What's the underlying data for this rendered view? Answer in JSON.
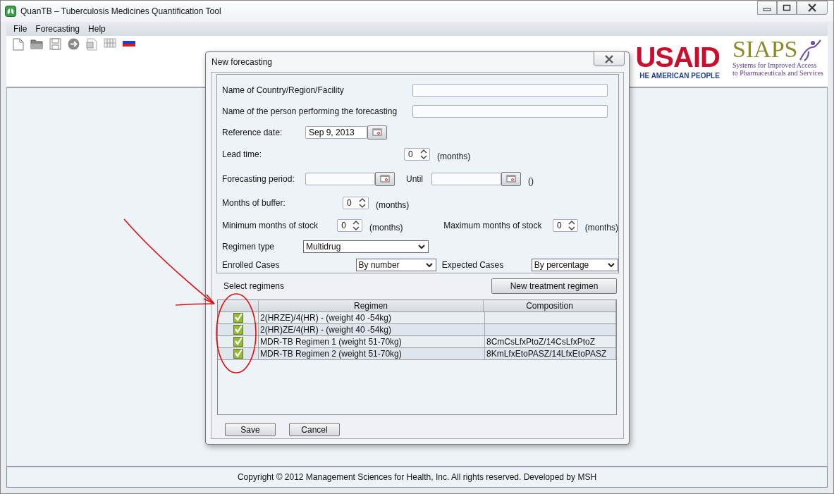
{
  "window": {
    "title": "QuanTB – Tuberculosis Medicines Quantification Tool"
  },
  "menu": [
    "File",
    "Forecasting",
    "Help"
  ],
  "logos": {
    "usaid": "USAID",
    "usaid_tagline": "HE AMERICAN PEOPLE",
    "siaps": "SIAPS",
    "siaps_tagline": [
      "Systems for Improved Access",
      "to Pharmaceuticals and Services"
    ]
  },
  "dialog": {
    "title": "New forecasting",
    "country_label": "Name of Country/Region/Facility",
    "person_label": "Name of the person performing the forecasting",
    "reference_label": "Reference date:",
    "reference_value": "Sep 9, 2013",
    "lead_label": "Lead time:",
    "lead_value": "0",
    "lead_unit": "(months)",
    "period_label": "Forecasting period:",
    "until_label": "Until",
    "period_unit": "()",
    "buffer_label": "Months of buffer:",
    "buffer_value": "0",
    "buffer_unit": "(months)",
    "min_label": "Minimum months of stock",
    "min_value": "0",
    "min_unit": "(months)",
    "max_label": "Maximum months of stock",
    "max_value": "0",
    "max_unit": "(months)",
    "regimen_type_label": "Regimen type",
    "regimen_type_value": "Multidrug",
    "enrolled_label": "Enrolled Cases",
    "enrolled_value": "By number",
    "expected_label": "Expected Cases",
    "expected_value": "By percentage",
    "select_label": "Select regimens",
    "new_regimen_button": "New treatment regimen",
    "table": {
      "columns": [
        "Regimen",
        "Composition"
      ],
      "rows": [
        {
          "checked": true,
          "regimen": "2(HRZE)/4(HR) - (weight 40 -54kg)"
        },
        {
          "checked": true,
          "regimen": "2(HR)ZE/4(HR) - (weight 40 -54kg)"
        },
        {
          "checked": true,
          "regimen": "MDR-TB Regimen 1 (weight 51-70kg)",
          "composition": "8CmCsLfxPtoZ/14CsLfxPtoZ"
        },
        {
          "checked": true,
          "regimen": "MDR-TB Regimen 2 (weight 51-70kg)",
          "composition": "8KmLfxEtoPASZ/14LfxEtoPASZ"
        }
      ]
    },
    "buttons": [
      "Save",
      "Cancel"
    ]
  },
  "footer": "Copyright © 2012 Management Sciences for Health, Inc. All rights reserved. Developed by MSH"
}
